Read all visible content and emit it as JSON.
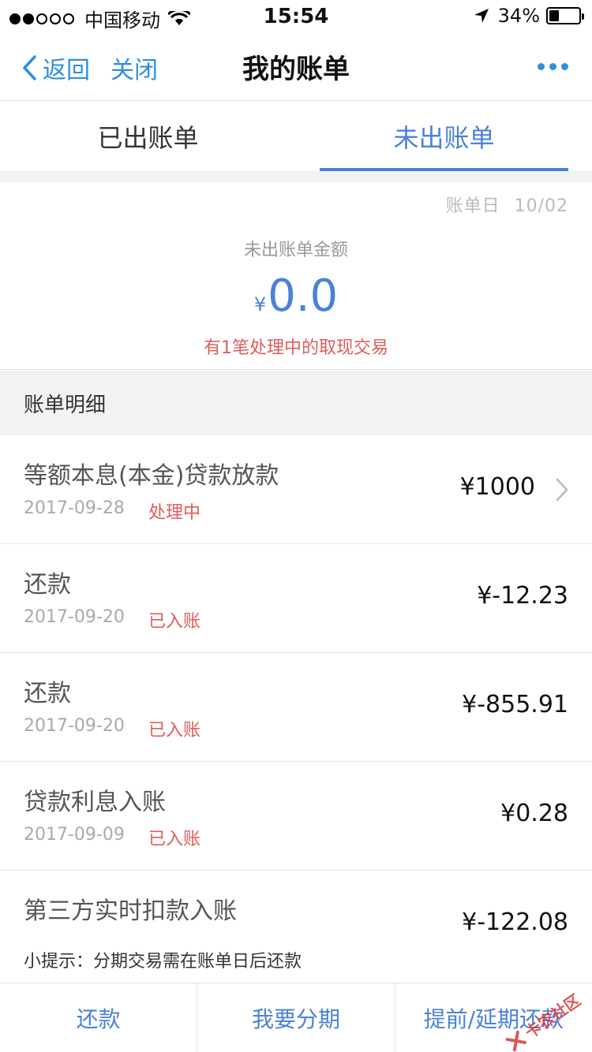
{
  "status_bar": {
    "carrier": "中国移动",
    "time": "15:54",
    "battery": "34%",
    "battery_level": 0.34
  },
  "nav": {
    "back_label": "返回",
    "close_label": "关闭",
    "title": "我的账单"
  },
  "tabs": [
    {
      "label": "已出账单",
      "active": false
    },
    {
      "label": "未出账单",
      "active": true
    }
  ],
  "summary": {
    "bill_day_label": "账单日",
    "bill_day_value": "10/02",
    "label": "未出账单金额",
    "currency": "¥",
    "amount": "0.0",
    "notice": "有1笔处理中的取现交易"
  },
  "section_title": "账单明细",
  "transactions": [
    {
      "title": "等额本息(本金)贷款放款",
      "date": "2017-09-28",
      "status": "处理中",
      "amount": "¥1000",
      "has_arrow": true
    },
    {
      "title": "还款",
      "date": "2017-09-20",
      "status": "已入账",
      "amount": "¥-12.23",
      "has_arrow": false
    },
    {
      "title": "还款",
      "date": "2017-09-20",
      "status": "已入账",
      "amount": "¥-855.91",
      "has_arrow": false
    },
    {
      "title": "贷款利息入账",
      "date": "2017-09-09",
      "status": "已入账",
      "amount": "¥0.28",
      "has_arrow": false
    },
    {
      "title": "第三方实时扣款入账",
      "date": "",
      "status": "",
      "amount": "¥-122.08",
      "has_arrow": false
    }
  ],
  "tip": "小提示：分期交易需在账单日后还款",
  "actions": [
    {
      "label": "还款"
    },
    {
      "label": "我要分期"
    },
    {
      "label": "提前/延期还款"
    }
  ],
  "watermark": "卡农社区",
  "colors": {
    "accent": "#4a82d6",
    "link": "#2d8fe0",
    "alert": "#e05b5b"
  }
}
